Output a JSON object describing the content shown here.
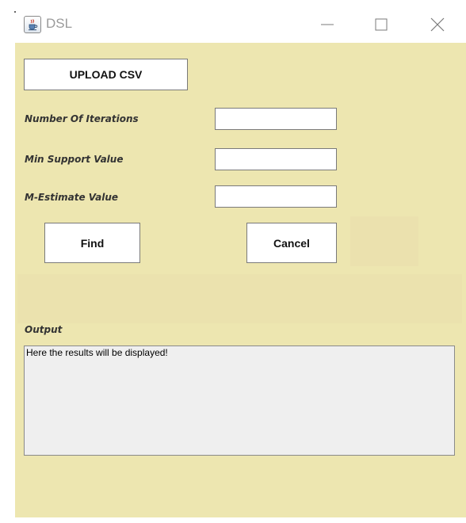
{
  "window": {
    "title": "DSL",
    "icon": "java-cup-icon"
  },
  "controls": {
    "minimize": "minimize-icon",
    "maximize": "maximize-icon",
    "close": "close-icon"
  },
  "form": {
    "upload_label": "UPLOAD CSV",
    "iterations_label": "Number Of Iterations",
    "iterations_value": "",
    "min_support_label": "Min Support Value",
    "min_support_value": "",
    "m_estimate_label": "M-Estimate Value",
    "m_estimate_value": "",
    "find_label": "Find",
    "cancel_label": "Cancel"
  },
  "output": {
    "label": "Output",
    "text": "Here the results will be displayed!"
  },
  "colors": {
    "panel_background": "#ede6b0",
    "output_background": "#efefef"
  }
}
